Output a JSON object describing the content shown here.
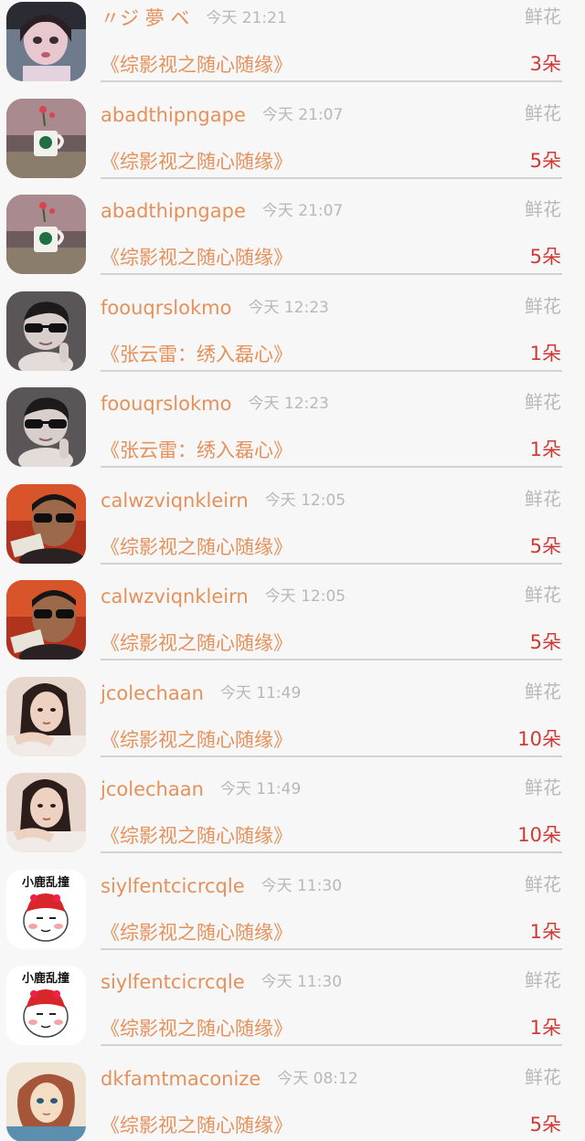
{
  "gift_list": [
    {
      "user": "〃ジ 夢 ベ",
      "time": "今天 21:21",
      "gift_type": "鲜花",
      "book": "《综影视之随心随缘》",
      "count": "3朵",
      "avatar_icon": "avatar-girl-icon",
      "avatar_style": "girl"
    },
    {
      "user": "abadthipngape",
      "time": "今天 21:07",
      "gift_type": "鲜花",
      "book": "《综影视之随心随缘》",
      "count": "5朵",
      "avatar_icon": "avatar-coffee-cup-icon",
      "avatar_style": "cup"
    },
    {
      "user": "abadthipngape",
      "time": "今天 21:07",
      "gift_type": "鲜花",
      "book": "《综影视之随心随缘》",
      "count": "5朵",
      "avatar_icon": "avatar-coffee-cup-icon",
      "avatar_style": "cup"
    },
    {
      "user": "foouqrslokmo",
      "time": "今天 12:23",
      "gift_type": "鲜花",
      "book": "《张云雷：绣入磊心》",
      "count": "1朵",
      "avatar_icon": "avatar-kid-sunglasses-icon",
      "avatar_style": "kid"
    },
    {
      "user": "foouqrslokmo",
      "time": "今天 12:23",
      "gift_type": "鲜花",
      "book": "《张云雷：绣入磊心》",
      "count": "1朵",
      "avatar_icon": "avatar-kid-sunglasses-icon",
      "avatar_style": "kid"
    },
    {
      "user": "calwzviqnkleirn",
      "time": "今天 12:05",
      "gift_type": "鲜花",
      "book": "《综影视之随心随缘》",
      "count": "5朵",
      "avatar_icon": "avatar-man-sunglasses-icon",
      "avatar_style": "man"
    },
    {
      "user": "calwzviqnkleirn",
      "time": "今天 12:05",
      "gift_type": "鲜花",
      "book": "《综影视之随心随缘》",
      "count": "5朵",
      "avatar_icon": "avatar-man-sunglasses-icon",
      "avatar_style": "man"
    },
    {
      "user": "jcolechaan",
      "time": "今天 11:49",
      "gift_type": "鲜花",
      "book": "《综影视之随心随缘》",
      "count": "10朵",
      "avatar_icon": "avatar-woman-portrait-icon",
      "avatar_style": "woman"
    },
    {
      "user": "jcolechaan",
      "time": "今天 11:49",
      "gift_type": "鲜花",
      "book": "《综影视之随心随缘》",
      "count": "10朵",
      "avatar_icon": "avatar-woman-portrait-icon",
      "avatar_style": "woman"
    },
    {
      "user": "siylfentcicrcqle",
      "time": "今天 11:30",
      "gift_type": "鲜花",
      "book": "《综影视之随心随缘》",
      "count": "1朵",
      "avatar_icon": "avatar-cartoon-sticker-icon",
      "avatar_style": "sticker",
      "avatar_caption": "小鹿乱撞"
    },
    {
      "user": "siylfentcicrcqle",
      "time": "今天 11:30",
      "gift_type": "鲜花",
      "book": "《综影视之随心随缘》",
      "count": "1朵",
      "avatar_icon": "avatar-cartoon-sticker-icon",
      "avatar_style": "sticker",
      "avatar_caption": "小鹿乱撞"
    },
    {
      "user": "dkfamtmaconize",
      "time": "今天 08:12",
      "gift_type": "鲜花",
      "book": "《综影视之随心随缘》",
      "count": "5朵",
      "avatar_icon": "avatar-anime-drawing-icon",
      "avatar_style": "anime"
    }
  ],
  "colors": {
    "background": "#f7f7f7",
    "username": "#e4915b",
    "book_title": "#e4915b",
    "timestamp": "#b8b8b8",
    "gift_type": "#b8b8b8",
    "count": "#cf3a35",
    "divider": "#d2d2d2"
  }
}
